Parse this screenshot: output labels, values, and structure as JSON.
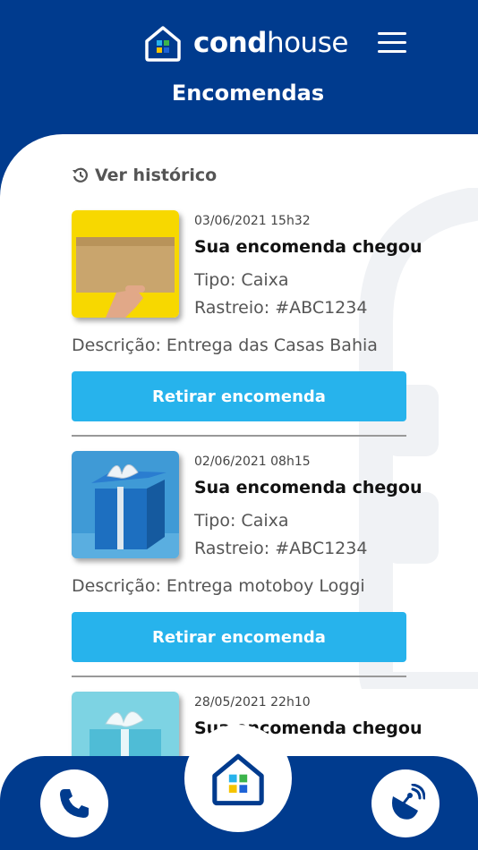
{
  "header": {
    "brand_bold": "cond",
    "brand_light": "house",
    "title": "Encomendas"
  },
  "history_link": "Ver histórico",
  "packages": [
    {
      "date": "03/06/2021 15h32",
      "title": "Sua encomenda chegou",
      "tipo": "Tipo: Caixa",
      "rastreio": "Rastreio: #ABC1234",
      "descricao": "Descrição: Entrega das Casas Bahia",
      "button": "Retirar encomenda"
    },
    {
      "date": "02/06/2021 08h15",
      "title": "Sua encomenda chegou",
      "tipo": "Tipo: Caixa",
      "rastreio": "Rastreio: #ABC1234",
      "descricao": "Descrição: Entrega motoboy Loggi",
      "button": "Retirar encomenda"
    },
    {
      "date": "28/05/2021 22h10",
      "title": "Sua encomenda chegou"
    }
  ],
  "bottom_nav": {
    "left_icon": "phone-icon",
    "center_icon": "home-icon",
    "right_icon": "satellite-dish-icon"
  },
  "colors": {
    "primary": "#003b8e",
    "button": "#27b3ec"
  }
}
